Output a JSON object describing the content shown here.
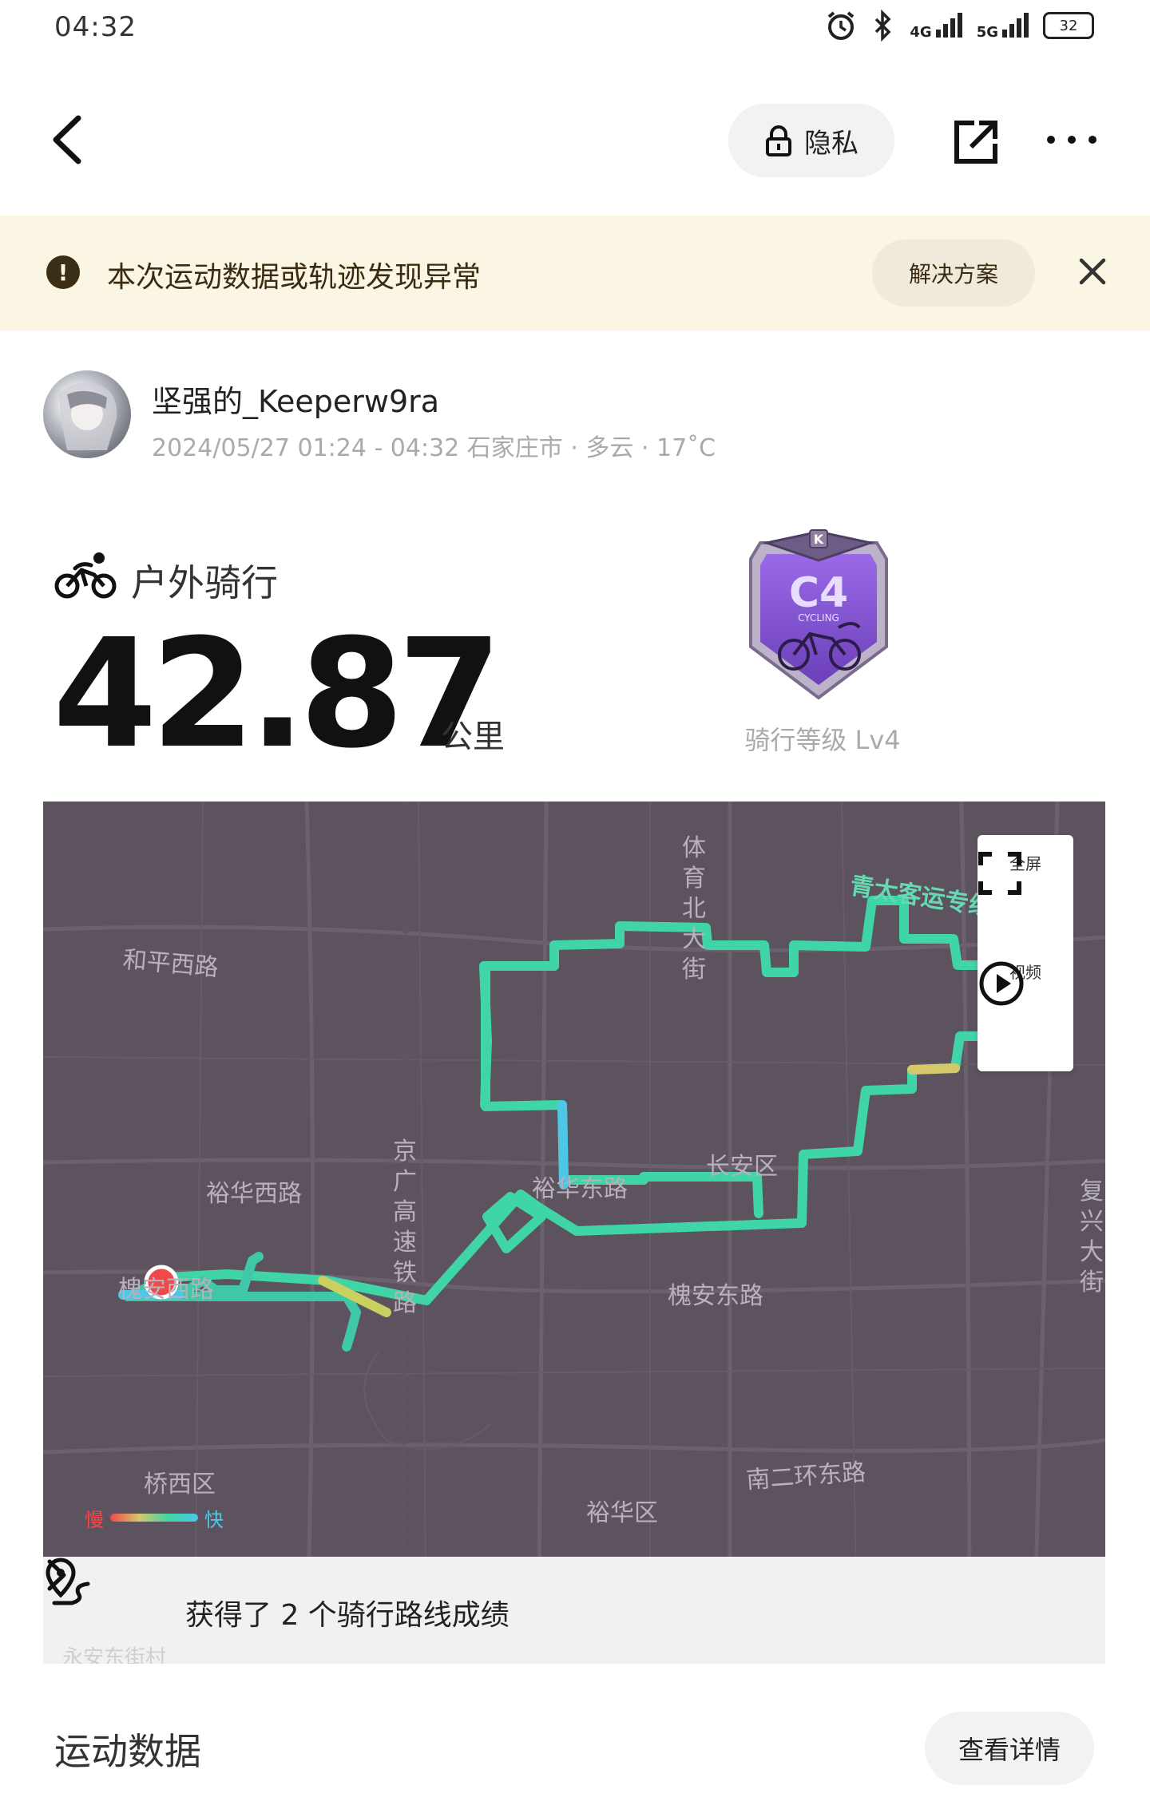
{
  "status_bar": {
    "time": "04:32",
    "network_1": "4G",
    "network_2": "5G",
    "battery": "32",
    "icons": [
      "alarm-icon",
      "bluetooth-icon",
      "signal-icon",
      "signal-icon",
      "battery-icon"
    ]
  },
  "nav": {
    "back_icon": "chevron-left-icon",
    "privacy_label": "隐私",
    "privacy_icon": "lock-icon",
    "share_icon": "share-icon",
    "more_icon": "more-icon"
  },
  "banner": {
    "message": "本次运动数据或轨迹发现异常",
    "solution_label": "解决方案",
    "icon": "exclamation-icon",
    "close_icon": "close-icon",
    "background": "#fbf5e4"
  },
  "user": {
    "name": "坚强的_Keeperw9ra",
    "meta": "2024/05/27 01:24 - 04:32 石家庄市 · 多云 · 17˚C"
  },
  "workout": {
    "type": "户外骑行",
    "icon": "cycling-icon",
    "distance": "42.87",
    "unit": "公里",
    "badge": {
      "code": "C4",
      "subtitle": "CYCLING",
      "top_letter": "K",
      "level": "骑行等级 Lv4",
      "color": "#8a5bd6"
    }
  },
  "map": {
    "background": "#5c535f",
    "route_color": "#3fd5a6",
    "labels": {
      "road_tiyu": "体育北大街",
      "road_qingtai": "青太客运专线",
      "road_heping": "和平西路",
      "road_yuhua_west": "裕华西路",
      "road_jingguang": "京广高速铁路",
      "road_yuhua_east": "裕华东路",
      "district_changan": "长安区",
      "road_huaian_west": "槐安西路",
      "road_huaian_east": "槐安东路",
      "road_fuxing": "复兴大街",
      "district_qiaoxi": "桥西区",
      "road_nanerhuan": "南二环东路",
      "district_yuhua": "裕华区",
      "road_yongan": "永安东街村"
    },
    "controls": {
      "fullscreen_label": "全屏",
      "video_label": "视频",
      "fullscreen_icon": "fullscreen-icon",
      "video_icon": "play-icon"
    },
    "legend": {
      "slow": "慢",
      "fast": "快"
    },
    "achievement": {
      "text": "获得了 2 个骑行路线成绩",
      "icon": "route-pin-icon",
      "chevron_icon": "chevron-right-icon"
    }
  },
  "footer": {
    "section_title": "运动数据",
    "detail_label": "查看详情"
  }
}
